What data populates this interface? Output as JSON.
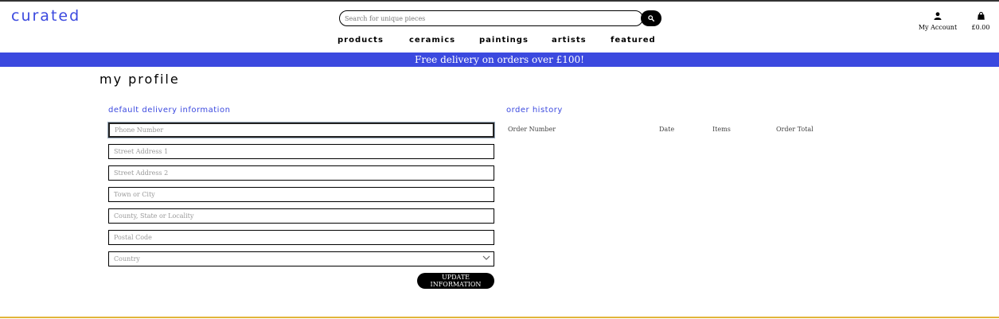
{
  "header": {
    "logo": "curated",
    "search_placeholder": "Search for unique pieces",
    "account_label": "My Account",
    "bag_total": "£0.00"
  },
  "nav": {
    "items": [
      "products",
      "ceramics",
      "paintings",
      "artists",
      "featured"
    ]
  },
  "banner": {
    "text": "Free delivery on orders over £100!"
  },
  "page": {
    "title": "my profile"
  },
  "delivery": {
    "title": "default delivery information",
    "fields": {
      "phone": "Phone Number",
      "street1": "Street Address 1",
      "street2": "Street Address 2",
      "town": "Town or City",
      "county": "County, State or Locality",
      "postcode": "Postal Code",
      "country": "Country"
    },
    "update_button": "UPDATE INFORMATION"
  },
  "order_history": {
    "title": "order history",
    "columns": [
      "Order Number",
      "Date",
      "Items",
      "Order Total"
    ]
  },
  "colors": {
    "accent": "#3b49df",
    "footer_line": "#e2b53a"
  },
  "icons": {
    "search": "search-icon",
    "account": "user-icon",
    "bag": "shopping-bag-icon",
    "dropdown": "chevron-down-icon"
  }
}
